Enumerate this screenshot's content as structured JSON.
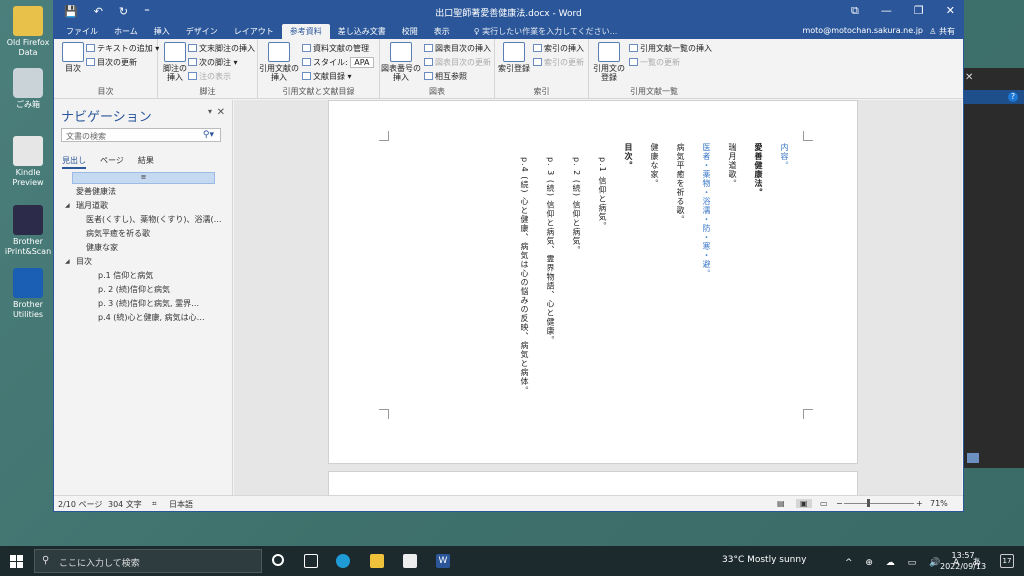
{
  "desktop": {
    "icons": [
      {
        "label": "Old Firefox Data",
        "name": "old-firefox-data-icon"
      },
      {
        "label": "ごみ箱",
        "name": "recycle-bin-icon"
      },
      {
        "label": "Kindle Preview",
        "name": "kindle-previewer-icon"
      },
      {
        "label": "Brother iPrint&Scan",
        "name": "brother-iprint-icon"
      },
      {
        "label": "Brother Utilities",
        "name": "brother-utilities-icon"
      }
    ]
  },
  "window": {
    "title": "出口聖師著愛善健康法.docx - Word",
    "qat": {
      "save": "💾",
      "undo": "↶",
      "redo": "↻",
      "customize": "⁼"
    },
    "buttons": {
      "ribbon_display": "⧉",
      "minimize": "—",
      "restore": "❐",
      "close": "✕"
    }
  },
  "tabs": [
    "ファイル",
    "ホーム",
    "挿入",
    "デザイン",
    "レイアウト",
    "参考資料",
    "差し込み文書",
    "校閲",
    "表示"
  ],
  "active_tab": "参考資料",
  "tell_me": "♀ 実行したい作業を入力してください...",
  "account": "moto@motochan.sakura.ne.jp",
  "share": "♙ 共有",
  "ribbon": {
    "toc": {
      "big": "目次",
      "update": "目次の更新",
      "add_text": "テキストの追加 ▾",
      "label": "目次"
    },
    "footnotes": {
      "big": "脚注の\n挿入",
      "insert_endnote": "文末脚注の挿入",
      "next_footnote": "次の脚注 ▾",
      "show_notes": "注の表示",
      "label": "脚注"
    },
    "citations": {
      "big": "引用文献の\n挿入",
      "manage": "資料文献の管理",
      "style": "スタイル:",
      "style_value": "APA",
      "bibliography": "文献目録 ▾",
      "label": "引用文献と文献目録"
    },
    "captions": {
      "big": "図表番号の\n挿入",
      "insert_tof": "図表目次の挿入",
      "update_tof": "図表目次の更新",
      "cross_ref": "相互参照",
      "label": "図表"
    },
    "index": {
      "big": "索引登録",
      "insert_index": "索引の挿入",
      "update_index": "索引の更新",
      "label": "索引"
    },
    "toa": {
      "big": "引用文の\n登録",
      "insert_toa": "引用文献一覧の挿入",
      "update_toa": "一覧の更新",
      "label": "引用文献一覧"
    }
  },
  "nav_pane": {
    "title": "ナビゲーション",
    "search_placeholder": "文書の検索",
    "tabs": [
      "見出し",
      "ページ",
      "結果"
    ],
    "selected_marker": "≡",
    "items": [
      {
        "text": "愛善健康法",
        "level": 1
      },
      {
        "text": "瑞月道歌",
        "level": 1,
        "collapse": "◢"
      },
      {
        "text": "医者(くすし)、薬物(くすり)、浴濡(…",
        "level": 2
      },
      {
        "text": "病気平癒を祈る歌",
        "level": 2
      },
      {
        "text": "健康な家",
        "level": 2
      },
      {
        "text": "目次",
        "level": 1,
        "collapse": "◢"
      },
      {
        "text": "p.1 信仰と病気",
        "level": 3
      },
      {
        "text": "p. 2 (続)信仰と病気",
        "level": 3
      },
      {
        "text": "p. 3 (続)信仰と病気, 霊界…",
        "level": 3
      },
      {
        "text": "p.4 (続)心と健康, 病気は心…",
        "level": 3
      }
    ]
  },
  "document": {
    "columns": [
      {
        "text": "内容。",
        "style": "blue"
      },
      {
        "text": "愛善健康法。",
        "style": "bold"
      },
      {
        "text": "瑞月道歌。",
        "style": "normal"
      },
      {
        "text": "医者・薬物・浴濡・防・寒・避。",
        "style": "blue"
      },
      {
        "text": "病気平癒を祈る歌。",
        "style": "normal"
      },
      {
        "text": "健康な家。",
        "style": "normal"
      },
      {
        "text": "目次。",
        "style": "bold"
      },
      {
        "text": "p.1 信仰と病気。",
        "style": "normal"
      },
      {
        "text": "p. 2 (続) 信仰と病気。",
        "style": "normal"
      },
      {
        "text": "p. 3 (続) 信仰と病気、霊界物語、心と健康。",
        "style": "normal"
      },
      {
        "text": "p.4 (続) 心と健康、病気は心の悩みの反映、病気と病体。",
        "style": "normal"
      }
    ]
  },
  "status": {
    "page": "2/10 ページ",
    "words": "304 文字",
    "lang": "日本語",
    "zoom": "71%",
    "minus": "−",
    "plus": "+"
  },
  "taskbar": {
    "search_placeholder": "ここに入力して検索",
    "weather": "33°C  Mostly sunny",
    "tray": "^ ⊕ ☁ ▭ 🔊 A あ",
    "time": "13:57",
    "date": "2022/09/13",
    "notifications": "17"
  }
}
